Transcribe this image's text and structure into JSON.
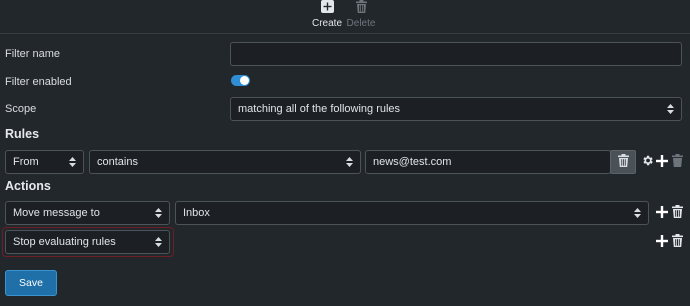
{
  "toolbar": {
    "create_label": "Create",
    "delete_label": "Delete"
  },
  "filter": {
    "name_label": "Filter name",
    "name_value": "",
    "enabled_label": "Filter enabled",
    "enabled": true,
    "scope_label": "Scope",
    "scope_value": "matching all of the following rules"
  },
  "rules": {
    "heading": "Rules",
    "items": [
      {
        "field": "From",
        "operator": "contains",
        "value": "news@test.com"
      }
    ]
  },
  "actions": {
    "heading": "Actions",
    "items": [
      {
        "action": "Move message to",
        "target": "Inbox"
      },
      {
        "action": "Stop evaluating rules"
      }
    ]
  },
  "footer": {
    "save_label": "Save"
  },
  "colors": {
    "background": "#22272c",
    "accent": "#2f8ed4",
    "save_button": "#1f6fa8",
    "highlight_border": "#6e1e24"
  },
  "icons": [
    "plus-square-icon",
    "trash-icon",
    "gear-icon",
    "plus-icon",
    "chevron-up-down-icon"
  ]
}
